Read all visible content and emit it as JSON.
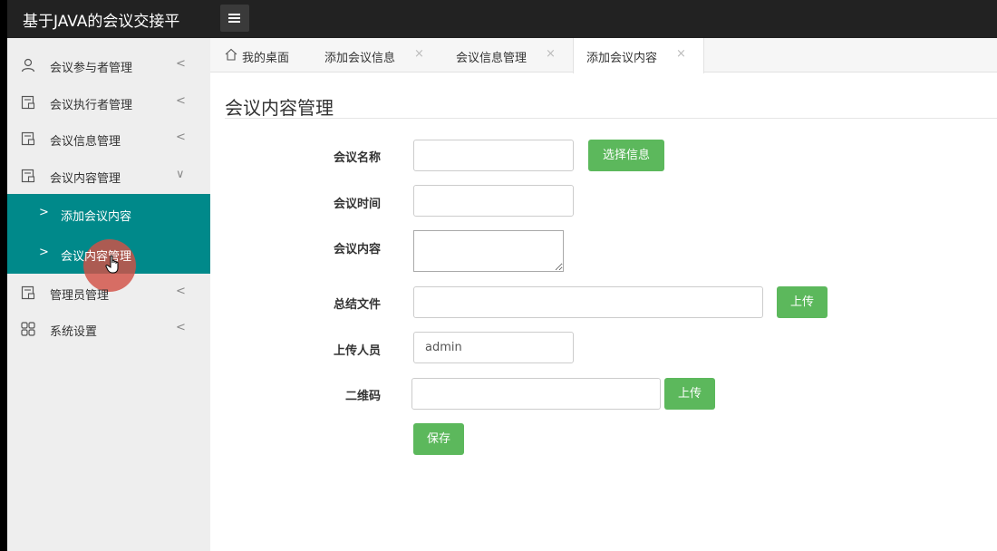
{
  "header": {
    "app_title": "基于JAVA的会议交接平"
  },
  "sidebar": {
    "items": [
      {
        "label": "会议参与者管理",
        "arrow": "<"
      },
      {
        "label": "会议执行者管理",
        "arrow": "<"
      },
      {
        "label": "会议信息管理",
        "arrow": "<"
      },
      {
        "label": "会议内容管理",
        "arrow": "∨"
      },
      {
        "label": "管理员管理",
        "arrow": "<"
      },
      {
        "label": "系统设置",
        "arrow": "<"
      }
    ],
    "subitems": [
      {
        "label": "添加会议内容",
        "chev": ">"
      },
      {
        "label": "会议内容管理",
        "chev": ">"
      }
    ]
  },
  "tabs": [
    {
      "label": "我的桌面"
    },
    {
      "label": "添加会议信息",
      "close": "×"
    },
    {
      "label": "会议信息管理",
      "close": "×"
    },
    {
      "label": "添加会议内容",
      "close": "×"
    }
  ],
  "page": {
    "title": "会议内容管理"
  },
  "form": {
    "meeting_name": {
      "label": "会议名称",
      "value": ""
    },
    "select_button": "选择信息",
    "meeting_time": {
      "label": "会议时间",
      "value": ""
    },
    "meeting_content": {
      "label": "会议内容",
      "value": ""
    },
    "summary_file": {
      "label": "总结文件",
      "value": ""
    },
    "upload_button": "上传",
    "uploader": {
      "label": "上传人员",
      "value": "admin"
    },
    "qrcode": {
      "label": "二维码",
      "value": ""
    },
    "save_button": "保存"
  },
  "colors": {
    "accent": "#00898a",
    "button": "#5cb85c",
    "topbar": "#222222",
    "sidebar": "#eeeeee"
  }
}
